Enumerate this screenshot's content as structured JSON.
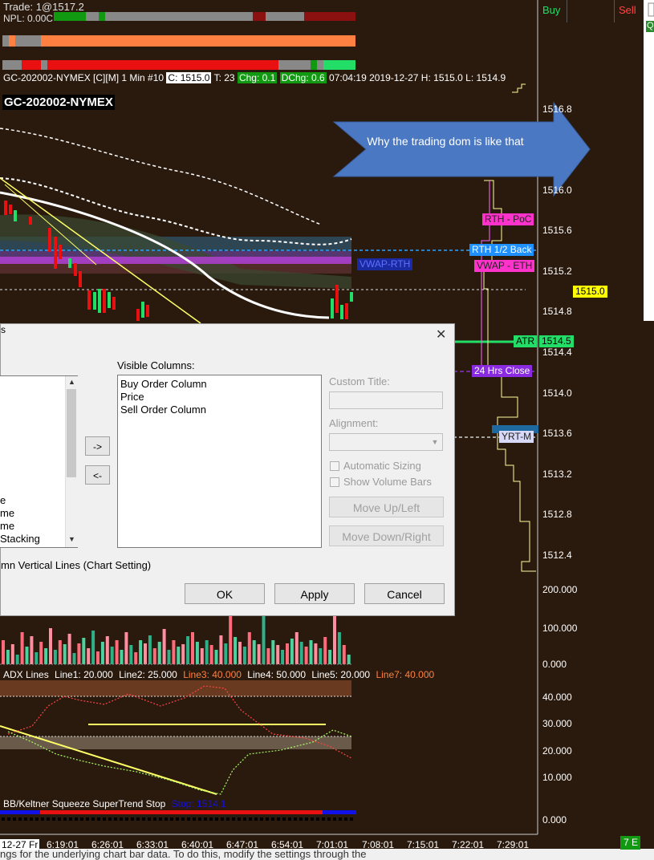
{
  "header": {
    "trade_line": "Trade: 1@1517.2",
    "npl_line": "NPL: 0.00C",
    "chart_title": "GC-202002-NYMEX [C][M]  1 Min   #10",
    "close": "C: 1515.0",
    "ticks": "T: 23",
    "chg": "Chg: 0.1",
    "dchg": "DChg: 0.6",
    "time_info": "07:04:19  2019-12-27  H: 1515.0  L: 1514.9",
    "symbol_label": "GC-202002-NYMEX"
  },
  "dom": {
    "buy_label": "Buy",
    "sell_label": "Sell",
    "right_edge_label": "Q",
    "bottom_badge": "7 E"
  },
  "callout": {
    "text": "Why the trading dom is like that",
    "color": "#4a78c2"
  },
  "price_axis": [
    "1516.8",
    "1516.0",
    "1515.6",
    "1515.2",
    "1514.8",
    "1514.4",
    "1514.0",
    "1513.6",
    "1513.2",
    "1512.8",
    "1512.4"
  ],
  "current_price": "1515.0",
  "level_tags": {
    "vwap_rth": "VWAP-RTH",
    "rth_poc": "RTH - PoC",
    "rth_half_back": "RTH 1/2 Back",
    "vwap_eth": "VWAP - ETH",
    "atr": "ATR",
    "atr_value": "1514.5",
    "close_24h": "24 Hrs Close",
    "yrt_m": "YRT-M"
  },
  "volume_axis": [
    "200.000",
    "100.000",
    "0.000"
  ],
  "adx": {
    "title": "ADX Lines",
    "line1": "Line1: 20.000",
    "line2": "Line2: 25.000",
    "line3": "Line3: 40.000",
    "line4": "Line4: 50.000",
    "line5": "Line5: 20.000",
    "line7": "Line7: 40.000",
    "axis": [
      "40.000",
      "30.000",
      "20.000",
      "10.000",
      "0.000"
    ]
  },
  "squeeze": {
    "title": "BB/Keltner Squeeze  SuperTrend Stop",
    "stop": "Stop: 1514.1"
  },
  "time_axis": [
    "12-27 Fr",
    "6:19:01",
    "6:26:01",
    "6:33:01",
    "6:40:01",
    "6:47:01",
    "6:54:01",
    "7:01:01",
    "7:08:01",
    "7:15:01",
    "7:22:01",
    "7:29:01"
  ],
  "dialog": {
    "title_fragment": "s",
    "close_glyph": "✕",
    "left_list_items": [
      "e",
      "me",
      "me",
      "Stacking"
    ],
    "visible_columns_label": "Visible Columns:",
    "visible_columns": [
      "Buy Order Column",
      "Price",
      "Sell Order Column"
    ],
    "add_arrow": "->",
    "remove_arrow": "<-",
    "custom_title_label": "Custom Title:",
    "alignment_label": "Alignment:",
    "automatic_sizing": "Automatic Sizing",
    "show_volume_bars": "Show Volume Bars",
    "move_up": "Move Up/Left",
    "move_down": "Move Down/Right",
    "vertical_lines_text": "mn Vertical Lines (Chart Setting)",
    "ok": "OK",
    "apply": "Apply",
    "cancel": "Cancel"
  },
  "footer_text": "ngs for the underlying chart bar data. To do this, modify the settings through the"
}
